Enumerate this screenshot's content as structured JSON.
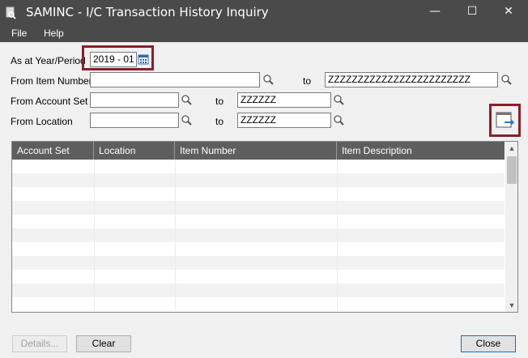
{
  "window": {
    "title": "SAMINC - I/C Transaction History Inquiry",
    "minimize_glyph": "—",
    "maximize_glyph": "☐",
    "close_glyph": "✕"
  },
  "menu": {
    "items": [
      {
        "label": "File"
      },
      {
        "label": "Help"
      }
    ]
  },
  "form": {
    "year_period": {
      "label": "As at Year/Period",
      "value": "2019 - 01"
    },
    "item_number": {
      "label": "From Item Number",
      "from": "",
      "to_label": "to",
      "to": "ZZZZZZZZZZZZZZZZZZZZZZZZ"
    },
    "account_set": {
      "label": "From Account Set",
      "from": "",
      "to_label": "to",
      "to": "ZZZZZZ"
    },
    "location": {
      "label": "From Location",
      "from": "",
      "to_label": "to",
      "to": "ZZZZZZ"
    }
  },
  "grid": {
    "columns": [
      {
        "label": "Account Set"
      },
      {
        "label": "Location"
      },
      {
        "label": "Item Number"
      },
      {
        "label": "Item Description"
      }
    ],
    "rows": []
  },
  "buttons": {
    "details": "Details...",
    "clear": "Clear",
    "close": "Close"
  },
  "icons": {
    "app": "document-search-icon",
    "finder": "magnifier-icon",
    "calendar": "calendar-icon",
    "go": "go-arrow-icon"
  },
  "colors": {
    "titlebar": "#4a4a4a",
    "grid_header": "#5e5e5e",
    "highlight_border": "#8b1e2b",
    "go_arrow": "#1e7ad4"
  }
}
